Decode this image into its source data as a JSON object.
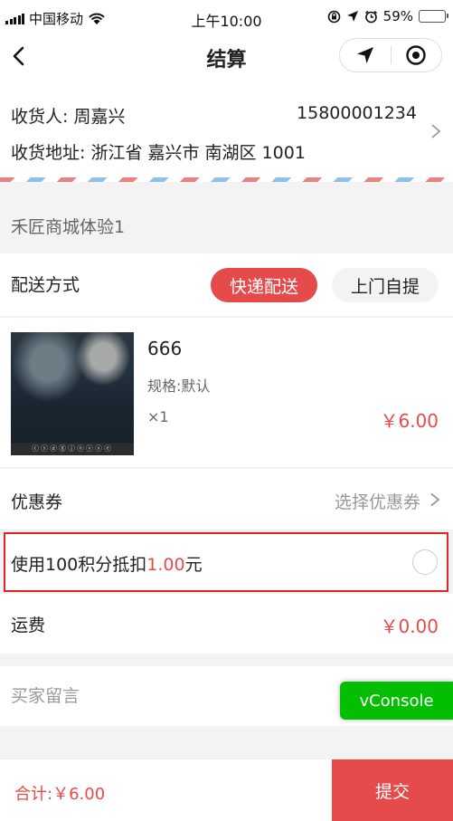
{
  "status_bar": {
    "carrier": "中国移动",
    "time": "上午10:00",
    "battery_percent": "59%",
    "battery_level": 0.59,
    "icons": [
      "signal-icon",
      "wifi-icon",
      "rotation-lock-icon",
      "location-arrow-icon",
      "alarm-icon",
      "battery-icon"
    ]
  },
  "nav": {
    "title": "结算",
    "icons": [
      "back-arrow-icon",
      "navigate-icon",
      "target-icon"
    ]
  },
  "address": {
    "receiver": "收货人: 周嘉兴",
    "phone": "15800001234",
    "address_line": "收货地址: 浙江省 嘉兴市 南湖区 1001"
  },
  "store": {
    "name": "禾匠商城体验1"
  },
  "delivery": {
    "label": "配送方式",
    "options": [
      "快递配送",
      "上门自提"
    ],
    "selected": "快递配送"
  },
  "product": {
    "name": "666",
    "spec": "规格:默认",
    "qty": "×1",
    "price": "￥6.00"
  },
  "coupon": {
    "label": "优惠券",
    "select_text": "选择优惠券"
  },
  "points": {
    "prefix": "使用100积分抵扣",
    "amount": "1.00",
    "suffix": "元",
    "checked": false
  },
  "shipping": {
    "label": "运费",
    "fee": "￥0.00"
  },
  "message": {
    "placeholder": "买家留言"
  },
  "vconsole": {
    "label": "vConsole"
  },
  "footer": {
    "total": "合计:￥6.00",
    "submit": "提交"
  },
  "colors": {
    "accent": "#e64b4b",
    "highlight_border": "#e02424",
    "vconsole": "#04be02"
  }
}
